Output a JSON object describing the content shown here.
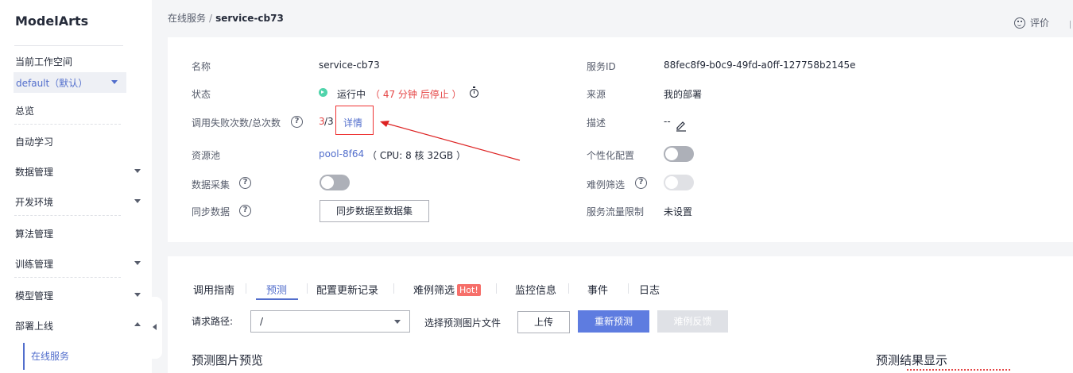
{
  "sidebar": {
    "brand": "ModelArts",
    "workspace_label": "当前工作空间",
    "workspace_value": "default（默认）",
    "items": [
      {
        "label": "总览"
      },
      {
        "label": "自动学习"
      },
      {
        "label": "数据管理"
      },
      {
        "label": "开发环境"
      },
      {
        "label": "算法管理"
      },
      {
        "label": "训练管理"
      },
      {
        "label": "模型管理"
      },
      {
        "label": "部署上线"
      }
    ],
    "sub_item": "在线服务"
  },
  "breadcrumb": {
    "parent": "在线服务",
    "separator": "/",
    "current": "service-cb73"
  },
  "header": {
    "feedback_label": "评价"
  },
  "info": {
    "name_label": "名称",
    "name_value": "service-cb73",
    "status_label": "状态",
    "status_value": "运行中",
    "status_note": "（ 47 分钟 后停止 ）",
    "fail_label": "调用失败次数/总次数",
    "fail_count": "3",
    "fail_total": " /3",
    "detail_link": "详情",
    "pool_label": "资源池",
    "pool_value": "pool-8f64",
    "pool_spec": "（ CPU: 8 核 32GB ）",
    "collect_label": "数据采集",
    "sync_label": "同步数据",
    "sync_button": "同步数据至数据集",
    "service_id_label": "服务ID",
    "service_id_value": "88fec8f9-b0c9-49fd-a0ff-127758b2145e",
    "source_label": "来源",
    "source_value": "我的部署",
    "desc_label": "描述",
    "desc_value": "--",
    "personal_label": "个性化配置",
    "hard_label": "难例筛选",
    "limit_label": "服务流量限制",
    "limit_value": "未设置"
  },
  "tabs": [
    {
      "label": "调用指南"
    },
    {
      "label": "预测"
    },
    {
      "label": "配置更新记录"
    },
    {
      "label": "难例筛选",
      "badge": "Hot!"
    },
    {
      "label": "监控信息"
    },
    {
      "label": "事件"
    },
    {
      "label": "日志"
    }
  ],
  "predict": {
    "path_label": "请求路径:",
    "path_value": "/",
    "file_label": "选择预测图片文件",
    "upload_button": "上传",
    "repredict_button": "重新预测",
    "hard_feedback_button": "难例反馈",
    "preview_title": "预测图片预览",
    "result_title": "预测结果显示"
  },
  "colors": {
    "accent": "#526ecc",
    "primary_button": "#5e7ce0",
    "error": "#e54545",
    "annotation": "#dd2222"
  }
}
